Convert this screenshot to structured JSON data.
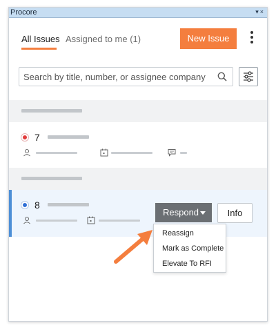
{
  "window": {
    "title": "Procore",
    "controls": "▾×"
  },
  "tabs": [
    {
      "label": "All Issues",
      "active": true
    },
    {
      "label": "Assigned to me (1)",
      "active": false
    }
  ],
  "header": {
    "new_issue_label": "New Issue"
  },
  "search": {
    "placeholder": "Search by title, number, or assignee company",
    "value": ""
  },
  "issues": [
    {
      "number": "7",
      "status_color": "#e23b3b",
      "selected": false
    },
    {
      "number": "8",
      "status_color": "#2f6fd6",
      "selected": true
    }
  ],
  "actions": {
    "respond_label": "Respond",
    "info_label": "Info"
  },
  "respond_menu": {
    "items": [
      "Reassign",
      "Mark as Complete",
      "Elevate To RFI"
    ]
  },
  "colors": {
    "accent": "#f47e3e",
    "selection_bar": "#4d8fd6",
    "respond_bg": "#6b6f73"
  }
}
